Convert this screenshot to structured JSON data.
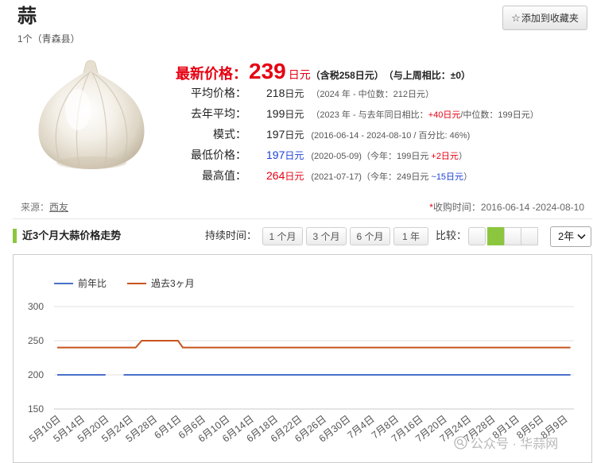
{
  "product": {
    "name": "蒜",
    "subtitle": "1个（青森县）"
  },
  "favorite": {
    "icon": "star-outline-icon",
    "glyph": "☆",
    "label": "添加到收藏夹"
  },
  "latest_price": {
    "label": "最新价格：",
    "value": "239",
    "unit": "日元",
    "tax_included": "（含税258日元）",
    "weekly_change": "（与上周相比：±0）",
    "color": "#e60012"
  },
  "stats": [
    {
      "label": "平均价格：",
      "value": "218",
      "unit": "日元",
      "value_color": "#222222",
      "detail": [
        {
          "text": "（2024 年 - 中位数：212日元）"
        }
      ]
    },
    {
      "label": "去年平均：",
      "value": "199",
      "unit": "日元",
      "value_color": "#222222",
      "detail": [
        {
          "text": "（2023 年 - 与去年同日相比："
        },
        {
          "text": "+40日元",
          "color": "#e60012"
        },
        {
          "text": "/中位数：199日元）"
        }
      ]
    },
    {
      "label": "模式：",
      "value": "197",
      "unit": "日元",
      "value_color": "#222222",
      "detail": [
        {
          "text": "(2016-06-14 - 2024-08-10 / 百分比: 46%)"
        }
      ]
    },
    {
      "label": "最低价格：",
      "value": "197",
      "unit": "日元",
      "value_color": "#1a3fd6",
      "detail": [
        {
          "text": "(2020-05-09)（今年：199日元 "
        },
        {
          "text": "+2日元",
          "color": "#e60012"
        },
        {
          "text": "）"
        }
      ]
    },
    {
      "label": "最高值：",
      "value": "264",
      "unit": "日元",
      "value_color": "#e60012",
      "detail": [
        {
          "text": "(2021-07-17)（今年：249日元 "
        },
        {
          "text": "~15日元",
          "color": "#1a3fd6"
        },
        {
          "text": "）"
        }
      ]
    }
  ],
  "source": {
    "label": "来源：",
    "link": "西友"
  },
  "collection_period": {
    "asterisk": "*",
    "asterisk_color": "#e60012",
    "label": "收购时间：",
    "range": "2016-06-14 -2024-08-10"
  },
  "section": {
    "title": "近3个月大蒜价格走势",
    "accent_color": "#8cc63f"
  },
  "duration": {
    "label": "持续时间：",
    "options": [
      "1 个月",
      "3 个月",
      "6 个月",
      "1 年"
    ]
  },
  "compare": {
    "label": "比较：",
    "selected_color": "#8cc63f",
    "options": [
      {
        "selected": false
      },
      {
        "selected": true
      },
      {
        "selected": false
      },
      {
        "selected": false
      }
    ]
  },
  "period_select": {
    "value": "2年",
    "icon": "chevron-down-icon"
  },
  "watermark": {
    "icon": "search-circle-icon",
    "text": "公众号 · 华蒜网"
  },
  "chart_data": {
    "type": "line",
    "x_ticks": [
      "5月10日",
      "5月14日",
      "5月20日",
      "5月24日",
      "5月28日",
      "6月1日",
      "6月6日",
      "6月10日",
      "6月14日",
      "6月18日",
      "6月22日",
      "6月26日",
      "6月30日",
      "7月4日",
      "7月8日",
      "7月16日",
      "7月20日",
      "7月24日",
      "7月28日",
      "8月1日",
      "8月5日",
      "8月9日"
    ],
    "ylim": [
      150,
      300
    ],
    "y_ticks": [
      300,
      250,
      200,
      150
    ],
    "grid": true,
    "legend_position": "top-left",
    "series": [
      {
        "name": "前年比",
        "color": "#4a6fc9",
        "points": [
          {
            "x": "5月10日",
            "y": 200
          },
          {
            "x": "5月20日",
            "y": 200
          },
          {
            "x": "5月21日",
            "y": null
          },
          {
            "x": "5月23日",
            "y": 200
          },
          {
            "x": "8月10日",
            "y": 200
          }
        ]
      },
      {
        "name": "過去3ヶ月",
        "color": "#c8541f",
        "points": [
          {
            "x": "5月10日",
            "y": 240
          },
          {
            "x": "5月25日",
            "y": 240
          },
          {
            "x": "5月26日",
            "y": 250
          },
          {
            "x": "6月1日",
            "y": 250
          },
          {
            "x": "6月2日",
            "y": 240
          },
          {
            "x": "8月10日",
            "y": 240
          }
        ]
      }
    ]
  }
}
